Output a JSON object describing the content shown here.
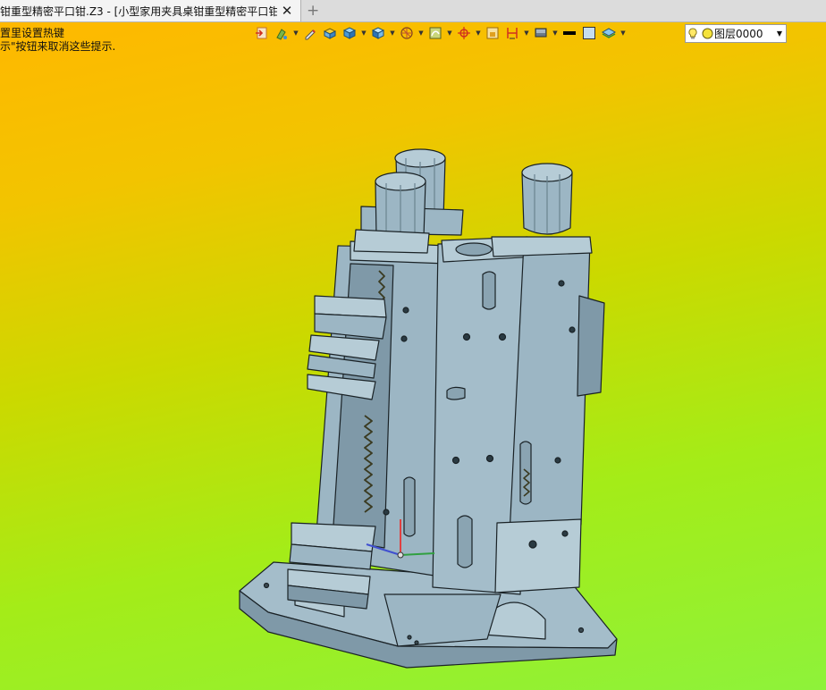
{
  "tab": {
    "title": "钳重型精密平口钳.Z3 - [小型家用夹具桌钳重型精密平口钳]",
    "close_glyph": "✕",
    "add_glyph": "+"
  },
  "hints": {
    "line1": "置里设置热键",
    "line2": "示\"按钮来取消这些提示."
  },
  "toolbar": {
    "icons": [
      "view-import-icon",
      "paint-icon",
      "pen-icon",
      "box-shade-icon",
      "cube-icon",
      "cube-view-icon",
      "wireframe-icon",
      "surface-icon",
      "center-icon",
      "align-icon",
      "dimension-icon",
      "display-icon",
      "line-color-icon",
      "fill-color-icon",
      "layer-stack-icon"
    ]
  },
  "layer_select": {
    "value": "图层0000"
  },
  "colors": {
    "model_fill": "#9cb6c4",
    "model_shade": "#7f99a8",
    "model_light": "#b6ccd6",
    "outline": "#1a2226"
  }
}
